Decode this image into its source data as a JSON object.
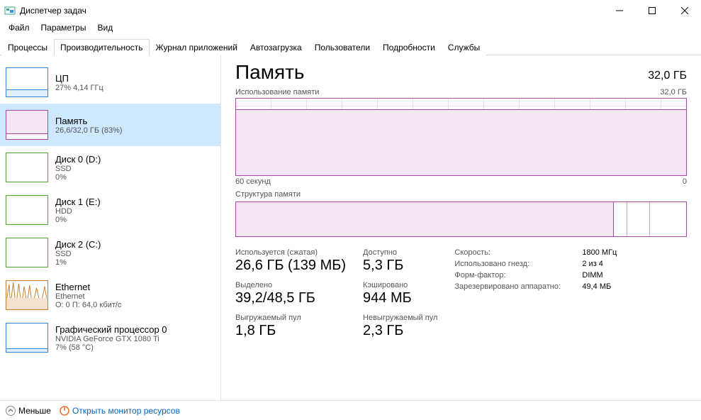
{
  "window": {
    "title": "Диспетчер задач"
  },
  "menu": {
    "file": "Файл",
    "options": "Параметры",
    "view": "Вид"
  },
  "tabs": {
    "processes": "Процессы",
    "performance": "Производительность",
    "apphistory": "Журнал приложений",
    "startup": "Автозагрузка",
    "users": "Пользователи",
    "details": "Подробности",
    "services": "Службы"
  },
  "sidebar": {
    "cpu": {
      "name": "ЦП",
      "sub": "27% 4,14 ГГц"
    },
    "mem": {
      "name": "Память",
      "sub": "26,6/32,0 ГБ (83%)"
    },
    "disk0": {
      "name": "Диск 0 (D:)",
      "sub1": "SSD",
      "sub2": "0%"
    },
    "disk1": {
      "name": "Диск 1 (E:)",
      "sub1": "HDD",
      "sub2": "0%"
    },
    "disk2": {
      "name": "Диск 2 (C:)",
      "sub1": "SSD",
      "sub2": "1%"
    },
    "eth": {
      "name": "Ethernet",
      "sub1": "Ethernet",
      "sub2": "О: 0 П: 64,0 кбит/с"
    },
    "gpu": {
      "name": "Графический процессор 0",
      "sub1": "NVIDIA GeForce GTX 1080 Ti",
      "sub2": "7% (58 °C)"
    }
  },
  "main": {
    "title": "Память",
    "capacity": "32,0 ГБ",
    "usage_label": "Использование памяти",
    "usage_max": "32,0 ГБ",
    "axis_left": "60 секунд",
    "axis_right": "0",
    "comp_label": "Структура памяти",
    "stats": {
      "inuse_label": "Используется (сжатая)",
      "inuse_value": "26,6 ГБ (139 МБ)",
      "avail_label": "Доступно",
      "avail_value": "5,3 ГБ",
      "committed_label": "Выделено",
      "committed_value": "39,2/48,5 ГБ",
      "cached_label": "Кэшировано",
      "cached_value": "944 МБ",
      "paged_label": "Выгружаемый пул",
      "paged_value": "1,8 ГБ",
      "nonpaged_label": "Невыгружаемый пул",
      "nonpaged_value": "2,3 ГБ"
    },
    "kv": {
      "speed_k": "Скорость:",
      "speed_v": "1800 МГц",
      "slots_k": "Использовано гнезд:",
      "slots_v": "2 из 4",
      "form_k": "Форм-фактор:",
      "form_v": "DIMM",
      "hw_k": "Зарезервировано аппаратно:",
      "hw_v": "49,4 МБ"
    }
  },
  "footer": {
    "fewer": "Меньше",
    "resmon": "Открыть монитор ресурсов"
  },
  "chart_data": {
    "type": "area",
    "title": "Использование памяти",
    "ylabel": "ГБ",
    "ylim": [
      0,
      32
    ],
    "x": [
      "60 секунд",
      "0"
    ],
    "series": [
      {
        "name": "Память",
        "approx_value_gb": 26.6,
        "percent": 83
      }
    ]
  }
}
